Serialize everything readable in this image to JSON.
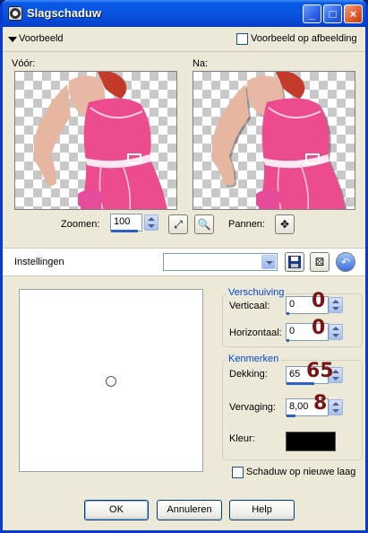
{
  "window": {
    "title": "Slagschaduw"
  },
  "preview_section": {
    "toggle_label": "Voorbeeld",
    "on_image_label": "Voorbeeld op afbeelding",
    "before_label": "Vóór:",
    "after_label": "Na:"
  },
  "zoom": {
    "label": "Zoomen:",
    "value": "100",
    "pan_label": "Pannen:"
  },
  "settings": {
    "label": "Instellingen",
    "preset_value": ""
  },
  "offset": {
    "title": "Verschuiving",
    "vertical_label": "Verticaal:",
    "vertical_value": "0",
    "vertical_annotation": "0",
    "horizontal_label": "Horizontaal:",
    "horizontal_value": "0",
    "horizontal_annotation": "0"
  },
  "properties": {
    "title": "Kenmerken",
    "opacity_label": "Dekking:",
    "opacity_value": "65",
    "opacity_annotation": "65",
    "blur_label": "Vervaging:",
    "blur_value": "8,00",
    "blur_annotation": "8",
    "color_label": "Kleur:",
    "color_value": "#000000"
  },
  "new_layer_label": "Schaduw op nieuwe laag",
  "buttons": {
    "ok": "OK",
    "cancel": "Annuleren",
    "help": "Help"
  },
  "colors": {
    "accent": "#0046d5",
    "annotation": "#7a1313",
    "titlebar": "#0a55e0"
  },
  "icons": {
    "navigator": "zoom-fit-icon",
    "zoom_tool": "magnifier-icon",
    "pan": "move-arrows-icon",
    "save_preset": "save-disk-icon",
    "randomize": "dice-icon",
    "reset": "reset-icon"
  }
}
